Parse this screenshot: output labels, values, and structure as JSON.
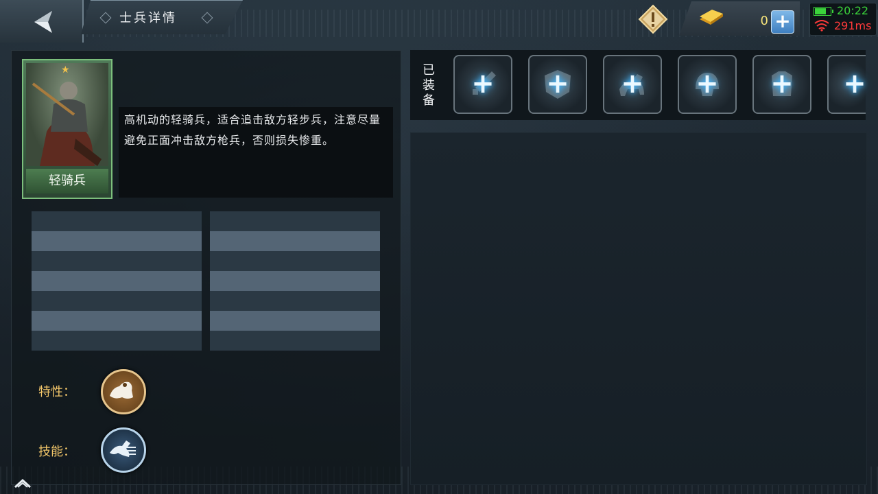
{
  "header": {
    "title": "士兵详情",
    "gold_value": "0",
    "status": {
      "time": "20:22",
      "ping": "291ms"
    }
  },
  "unit": {
    "name": "轻骑兵",
    "stars": 1,
    "description": "高机动的轻骑兵，适合追击敌方轻步兵，注意尽量避免正面冲击敌方枪兵，否则损失惨重。"
  },
  "labels": {
    "trait": "特性：",
    "skill": "技能："
  },
  "equipment": {
    "label": "已装备",
    "slots": [
      {
        "name": "weapon-slot",
        "icon": "sword-icon"
      },
      {
        "name": "shield-slot",
        "icon": "shield-icon"
      },
      {
        "name": "horse-slot",
        "icon": "horse-icon"
      },
      {
        "name": "helmet-slot",
        "icon": "helmet-icon"
      },
      {
        "name": "armor-slot",
        "icon": "armor-icon"
      },
      {
        "name": "extra-slot",
        "icon": "accessory-icon"
      }
    ]
  },
  "colors": {
    "gold_text": "#f4e27a",
    "label_text": "#f2c66a",
    "time_green": "#3bd33b",
    "ping_red": "#ff3a3a",
    "glow_blue": "#3fb6ff"
  }
}
